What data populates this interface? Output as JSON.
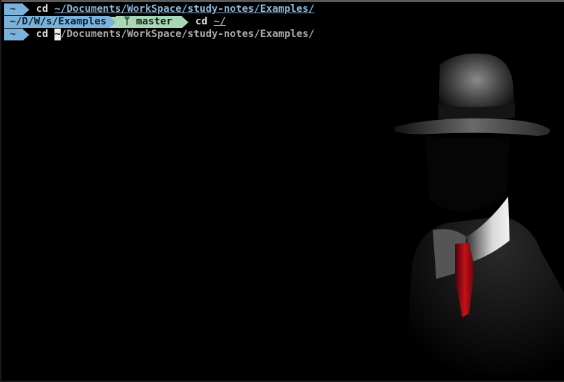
{
  "lines": [
    {
      "home": "~",
      "command": "cd",
      "argument": "~/Documents/WorkSpace/study-notes/Examples/"
    },
    {
      "directory": "~/D/W/s/Examples",
      "git_branch_icon": "branch-icon",
      "git_branch": "ᛘ master",
      "command": "cd",
      "argument": "~/"
    },
    {
      "home": "~",
      "command": "cd",
      "argument_cursor_char": "~",
      "argument_rest": "/Documents/WorkSpace/study-notes/Examples/"
    }
  ],
  "colors": {
    "background": "#000000",
    "prompt_blue": "#7ab2dc",
    "prompt_green": "#a9d6b5",
    "path_text": "#8fb6d8",
    "tie_red": "#b0101a"
  }
}
